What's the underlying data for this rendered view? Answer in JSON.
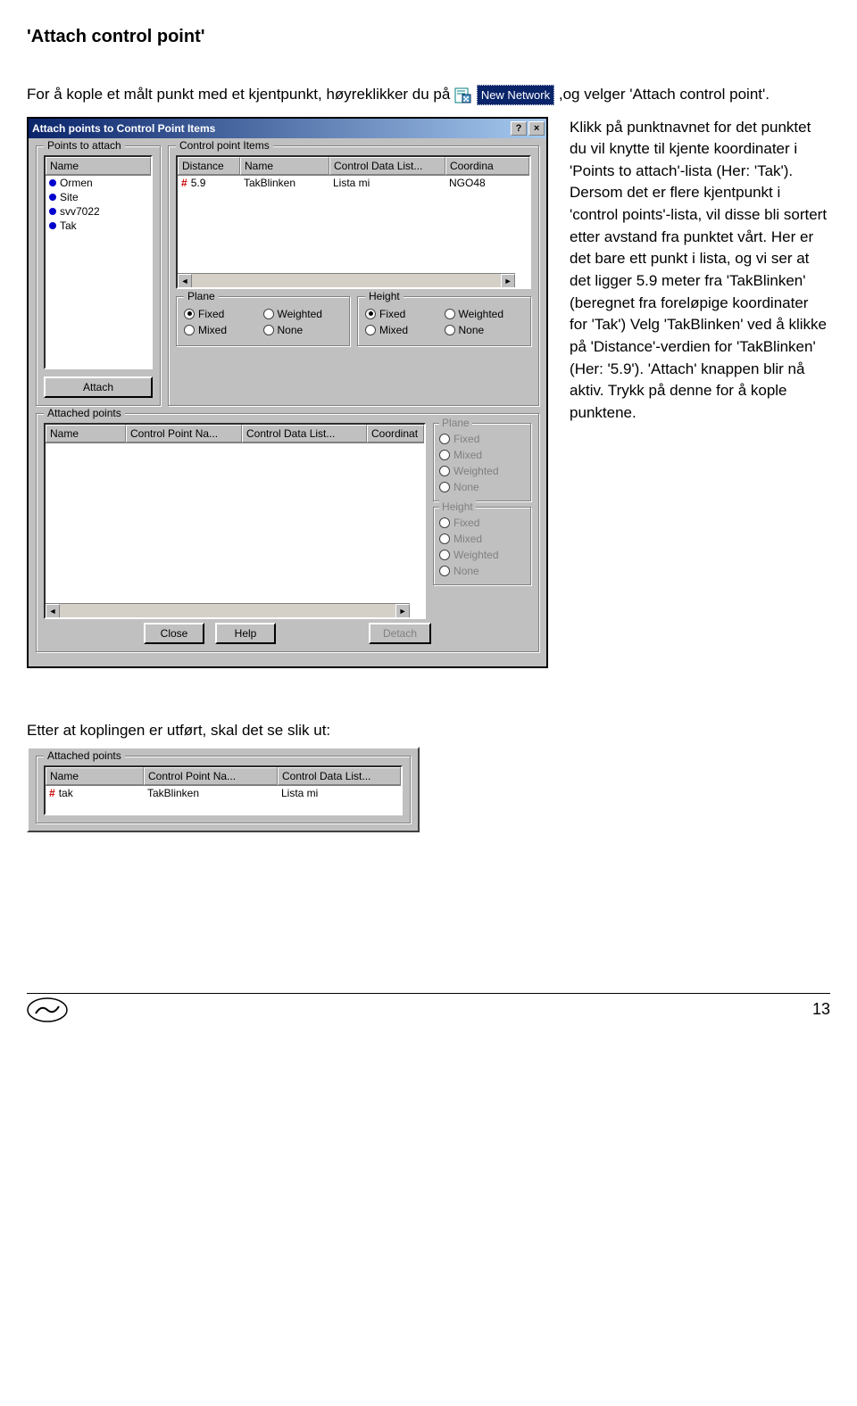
{
  "heading": "'Attach control point'",
  "intro_before": "For å kople et målt punkt med et kjentpunkt, høyreklikker du på ",
  "new_network": "New Network",
  "intro_after": ",og velger 'Attach control point'.",
  "dialog": {
    "title": "Attach points to Control Point Items",
    "help_btn": "?",
    "close_btn": "×",
    "points_group": "Points to attach",
    "cpitems_group": "Control point Items",
    "pta_cols": [
      "Name"
    ],
    "pta_rows": [
      "Ormen",
      "Site",
      "svv7022",
      "Tak"
    ],
    "cpi_cols": [
      "Distance",
      "Name",
      "Control Data List...",
      "Coordina"
    ],
    "cpi_row": {
      "dist": "5.9",
      "name": "TakBlinken",
      "cdl": "Lista mi",
      "coord": "NGO48"
    },
    "attach_btn": "Attach",
    "plane_group": "Plane",
    "height_group": "Height",
    "radios": [
      "Fixed",
      "Weighted",
      "Mixed",
      "None"
    ],
    "attached_group": "Attached points",
    "att_cols": [
      "Name",
      "Control Point Na...",
      "Control Data List...",
      "Coordinat"
    ],
    "rt_plane_group": "Plane",
    "rt_height_group": "Height",
    "rt_radios": [
      "Fixed",
      "Mixed",
      "Weighted",
      "None"
    ],
    "btn_close": "Close",
    "btn_help": "Help",
    "btn_detach": "Detach"
  },
  "sidetext": "Klikk på punktnavnet for det punktet du vil knytte til kjente koordinater i 'Points to attach'-lista (Her: 'Tak'). Dersom det er flere kjentpunkt i 'control points'-lista, vil disse bli sortert etter avstand fra punktet vårt. Her er det bare ett punkt i lista, og vi ser at det ligger 5.9 meter fra 'TakBlinken' (beregnet fra foreløpige koordinater for 'Tak') Velg 'TakBlinken' ved å klikke på 'Distance'-verdien for 'TakBlinken' (Her: '5.9'). 'Attach' knappen blir nå aktiv. Trykk på denne for å kople punktene.",
  "after_label": "Etter at koplingen er utført, skal det se slik ut:",
  "snippet": {
    "group": "Attached points",
    "cols": [
      "Name",
      "Control Point Na...",
      "Control Data List..."
    ],
    "row": {
      "name": "tak",
      "cpn": "TakBlinken",
      "cdl": "Lista mi"
    }
  },
  "page_number": "13"
}
